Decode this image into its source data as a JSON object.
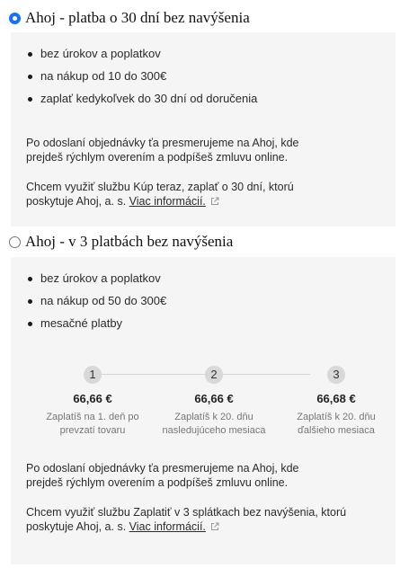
{
  "option1": {
    "title": "Ahoj - platba o 30 dní bez navýšenia",
    "selected": true,
    "features": [
      "bez úrokov a poplatkov",
      "na nákup od 10 do 300€",
      "zaplať kedykoľvek do 30 dní od doručenia"
    ],
    "redirect_text_line1": "Po odoslaní objednávky ťa presmerujeme na Ahoj, kde",
    "redirect_text_line2": "prejdeš rýchlym overením a podpíšeš zmluvu online.",
    "service_text_line1": "Chcem využiť službu Kúp teraz, zaplať o 30 dní, ktorú",
    "service_text_prefix": "poskytuje Ahoj, a. s.",
    "more_info_link": "Viac informácií."
  },
  "option2": {
    "title": "Ahoj - v 3 platbách bez navýšenia",
    "selected": false,
    "features": [
      "bez úrokov a poplatkov",
      "na nákup od 50 do 300€",
      "mesačné platby"
    ],
    "installments": [
      {
        "number": "1",
        "amount": "66,66 €",
        "desc_line1": "Zaplatíš na 1. deň po",
        "desc_line2": "prevzatí tovaru"
      },
      {
        "number": "2",
        "amount": "66,66 €",
        "desc_line1": "Zaplatíš k 20. dňu",
        "desc_line2": "nasledujúceho mesiaca"
      },
      {
        "number": "3",
        "amount": "66,68 €",
        "desc_line1": "Zaplatíš k 20. dňu",
        "desc_line2": "ďalšieho mesiaca"
      }
    ],
    "redirect_text_line1": "Po odoslaní objednávky ťa presmerujeme na Ahoj, kde",
    "redirect_text_line2": "prejdeš rýchlym overením a podpíšeš zmluvu online.",
    "service_text_line1": "Chcem využiť službu Zaplatiť v 3 splátkach bez navýšenia, ktorú",
    "service_text_prefix": "poskytuje Ahoj, a. s.",
    "more_info_link": "Viac informácií."
  },
  "colors": {
    "radio_accent": "#1a73e8",
    "panel_background": "#f4f5f4"
  },
  "icons": {
    "external_link": "external-link-icon"
  }
}
